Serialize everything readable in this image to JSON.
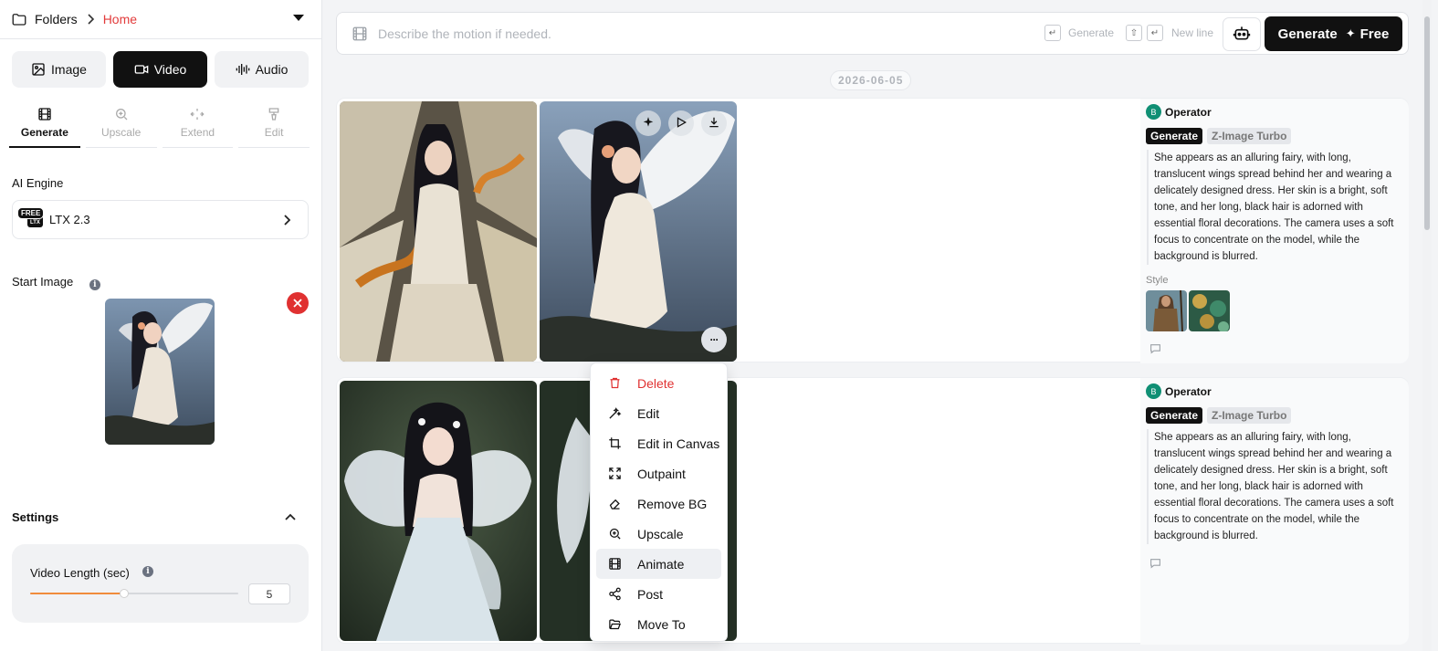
{
  "breadcrumb": {
    "folders": "Folders",
    "current": "Home"
  },
  "media_tabs": [
    {
      "label": "Image",
      "icon": "image-icon"
    },
    {
      "label": "Video",
      "icon": "video-camera-icon",
      "active": true
    },
    {
      "label": "Audio",
      "icon": "audio-wave-icon"
    }
  ],
  "tool_tabs": [
    {
      "label": "Generate",
      "active": true
    },
    {
      "label": "Upscale"
    },
    {
      "label": "Extend"
    },
    {
      "label": "Edit"
    }
  ],
  "ai_engine": {
    "label": "AI Engine",
    "badge": "FREE",
    "logo_text": "LTX",
    "name": "LTX 2.3"
  },
  "start_image": {
    "label": "Start Image"
  },
  "settings": {
    "label": "Settings",
    "video_length": {
      "label": "Video Length (sec)",
      "value": "5",
      "slider_fraction": 0.45
    }
  },
  "prompt": {
    "placeholder": "Describe the motion if needed.",
    "enter_key": "↵",
    "generate_hint": "Generate",
    "shift_key": "⇧",
    "newline_hint": "New line",
    "button_label": "Generate",
    "button_spark": "✦",
    "button_suffix": "Free"
  },
  "date_separator": "2026-06-05",
  "cards": [
    {
      "operator_initial": "B",
      "operator": "Operator",
      "mode": "Generate",
      "model": "Z-Image Turbo",
      "description": "She appears as an alluring fairy, with long, translucent wings spread behind her and wearing a delicately designed dress. Her skin is a bright, soft tone, and her long, black hair is adorned with essential floral decorations. The camera uses a soft focus to concentrate on the model, while the background is blurred.",
      "style_label": "Style"
    },
    {
      "operator_initial": "B",
      "operator": "Operator",
      "mode": "Generate",
      "model": "Z-Image Turbo",
      "description": "She appears as an alluring fairy, with long, translucent wings spread behind her and wearing a delicately designed dress. Her skin is a bright, soft tone, and her long, black hair is adorned with essential floral decorations. The camera uses a soft focus to concentrate on the model, while the background is blurred."
    }
  ],
  "context_menu": [
    {
      "label": "Delete",
      "icon": "trash-icon",
      "danger": true
    },
    {
      "label": "Edit",
      "icon": "magic-wand-icon"
    },
    {
      "label": "Edit in Canvas",
      "icon": "crop-icon"
    },
    {
      "label": "Outpaint",
      "icon": "expand-icon"
    },
    {
      "label": "Remove BG",
      "icon": "eraser-icon"
    },
    {
      "label": "Upscale",
      "icon": "zoom-in-icon"
    },
    {
      "label": "Animate",
      "icon": "film-icon",
      "highlighted": true
    },
    {
      "label": "Post",
      "icon": "share-icon"
    },
    {
      "label": "Move To",
      "icon": "folder-open-icon"
    }
  ],
  "more_button": "···",
  "colors": {
    "accent": "#e23b3b",
    "slider": "#f08c3c",
    "operator_avatar": "#0f8f74",
    "danger": "#e03131"
  }
}
